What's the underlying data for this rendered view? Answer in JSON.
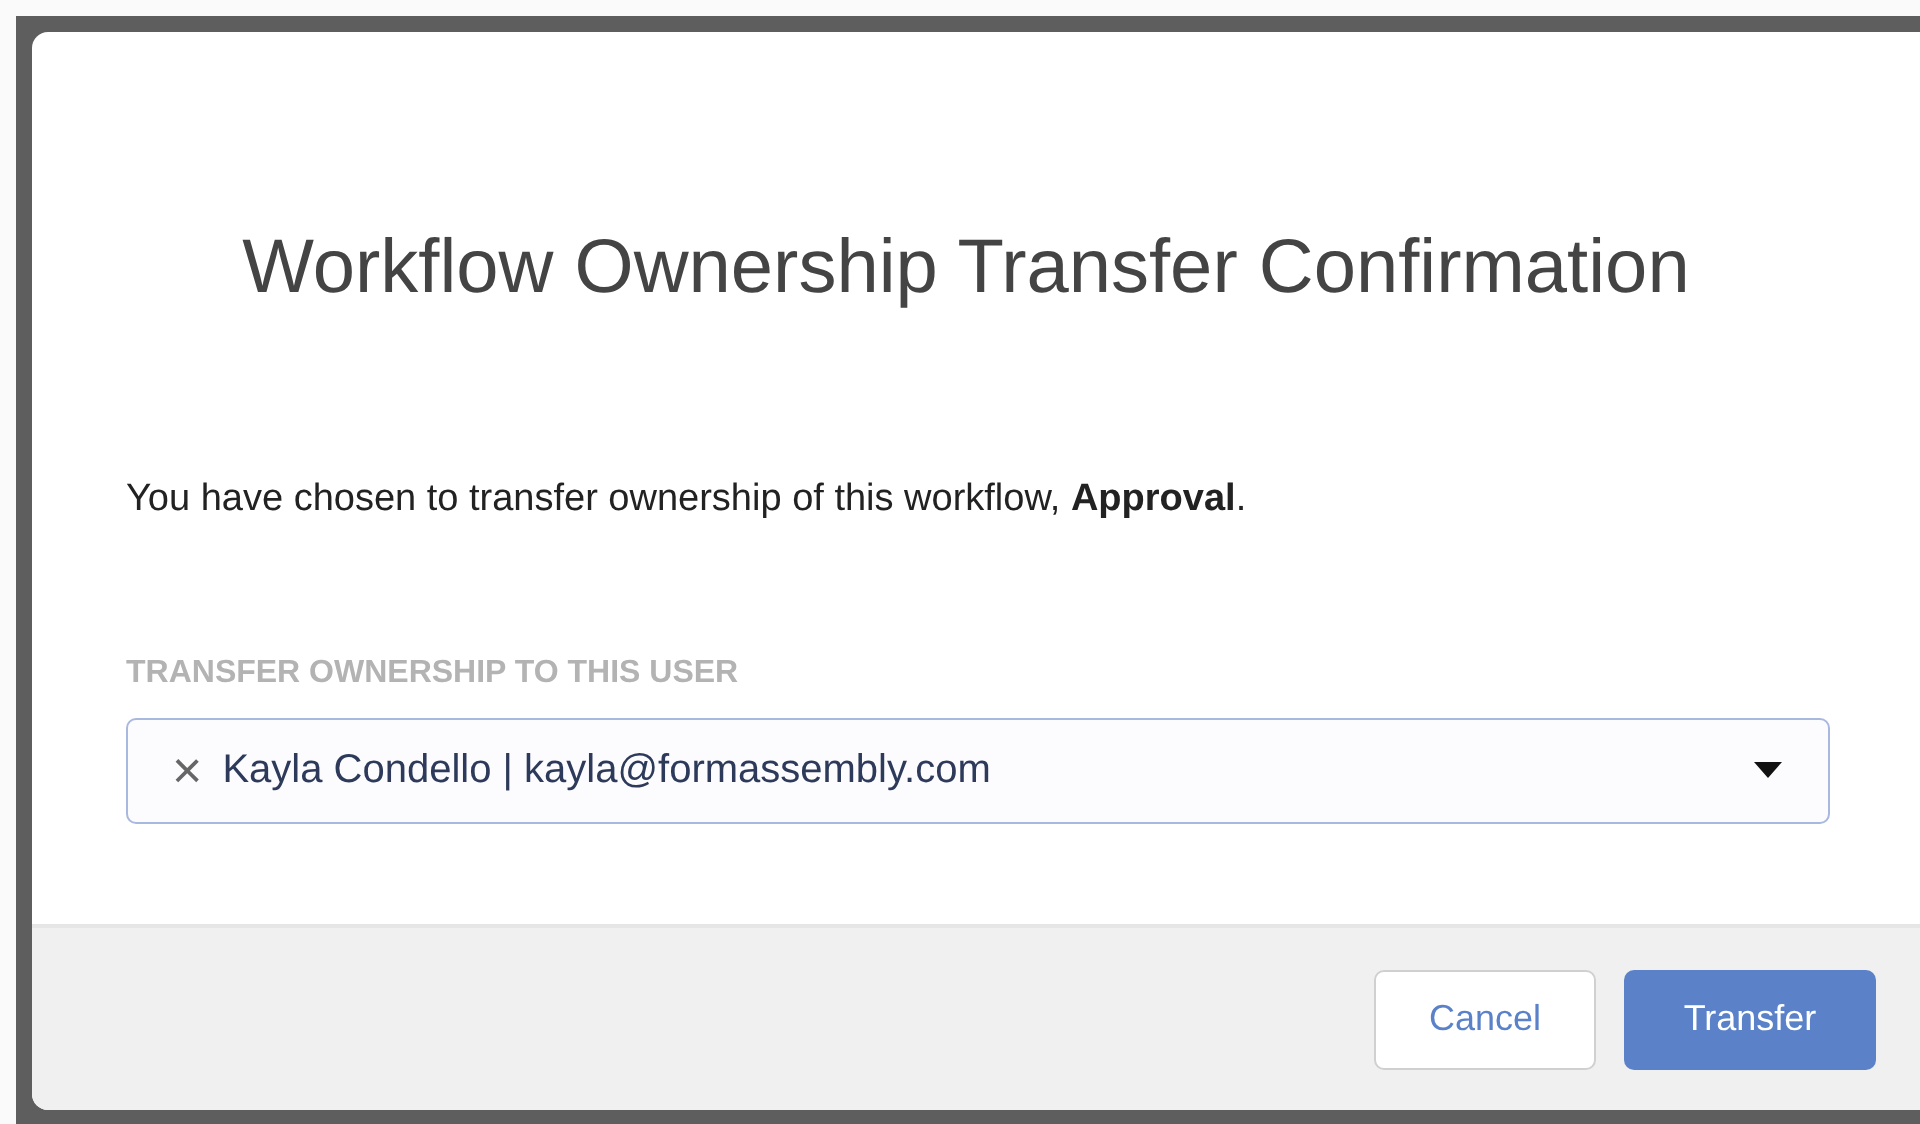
{
  "dialog": {
    "title": "Workflow Ownership Transfer Confirmation",
    "message": "You have chosen to transfer ownership of this workflow, **Approval**.",
    "field": {
      "label": "TRANSFER OWNERSHIP TO THIS USER",
      "clear": "×",
      "value": "Kayla Condello | kayla@formassembly.com"
    },
    "buttons": [
      {
        "label": "Cancel",
        "kind": "secondary"
      },
      {
        "label": "Transfer",
        "kind": "primary"
      }
    ]
  }
}
